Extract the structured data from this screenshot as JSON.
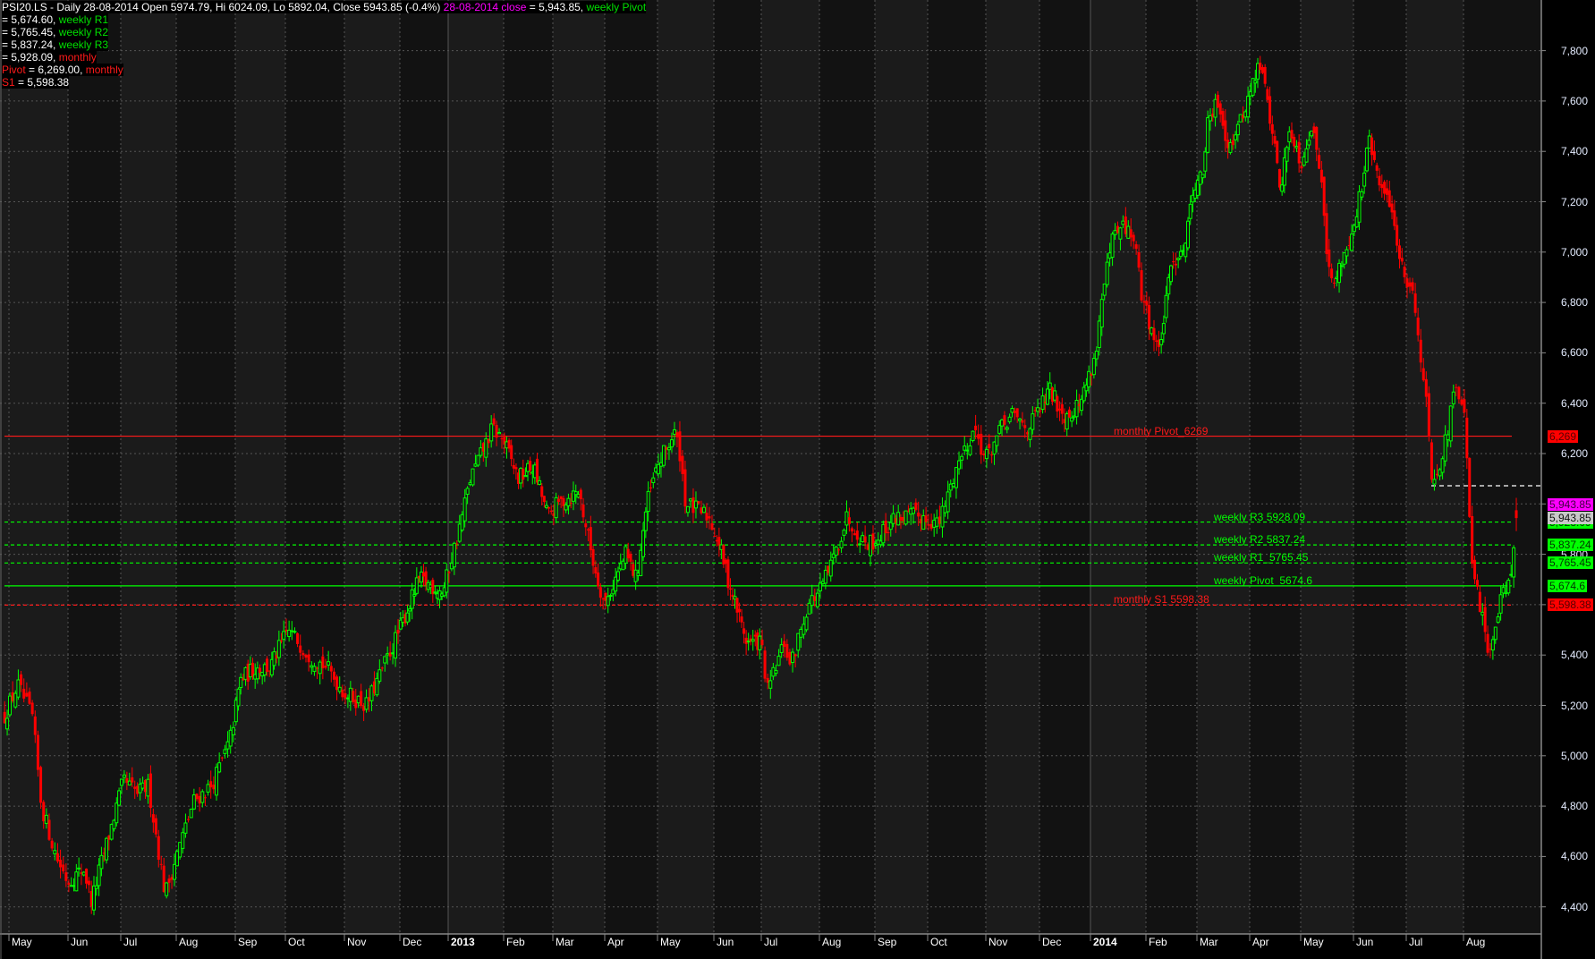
{
  "legend": {
    "line1": {
      "title": "PSI20.LS - Daily 28-08-2014 Open 5974.79, Hi 6024.09, Lo 5892.04, Close 5943.85 (-0.4%)",
      "close_label": "28-08-2014 close",
      "close_value": " = 5,943.85, ",
      "next_label": "weekly Pivot"
    },
    "rows": [
      {
        "prefix": "",
        "value": " = 5,674.60, ",
        "label": "weekly R1",
        "color": "grn"
      },
      {
        "prefix": "",
        "value": " = 5,765.45, ",
        "label": "weekly R2",
        "color": "grn"
      },
      {
        "prefix": "",
        "value": " = 5,837.24, ",
        "label": "weekly R3",
        "color": "grn"
      },
      {
        "prefix": "",
        "value": " = 5,928.09, ",
        "label": "monthly",
        "color": "red"
      },
      {
        "prefix": "Pivot",
        "value": " = 6,269.00, ",
        "label": "monthly",
        "color": "red"
      },
      {
        "prefix": "S1",
        "value": " = 5,598.38",
        "label": "",
        "color": "red"
      }
    ]
  },
  "colors": {
    "up": "#00ff00",
    "down": "#ff0000",
    "weekly": "#00ff00",
    "monthly": "#ff1a1a",
    "close": "#ff00ff",
    "grid": "#555555"
  },
  "chart_data": {
    "type": "candlestick",
    "symbol": "PSI20.LS",
    "interval": "Daily",
    "last_bar": {
      "date": "28-08-2014",
      "open": 5974.79,
      "high": 6024.09,
      "low": 5892.04,
      "close": 5943.85,
      "change_pct": -0.4
    },
    "x_ticks": [
      "May",
      "Jun",
      "Jul",
      "Aug",
      "Sep",
      "Oct",
      "Nov",
      "Dec",
      "2013",
      "Feb",
      "Mar",
      "Apr",
      "May",
      "Jun",
      "Jul",
      "Aug",
      "Sep",
      "Oct",
      "Nov",
      "Dec",
      "2014",
      "Feb",
      "Mar",
      "Apr",
      "May",
      "Jun",
      "Jul",
      "Aug"
    ],
    "y_ticks": [
      7800,
      7600,
      7400,
      7200,
      7000,
      6800,
      6600,
      6400,
      6200,
      6000,
      5800,
      5600,
      5400,
      5200,
      5000,
      4800,
      4600,
      4400
    ],
    "y_tick_labels": [
      "7,800",
      "7,600",
      "7,400",
      "7,200",
      "7,000",
      "6,800",
      "6,600",
      "6,400",
      "6,200",
      "6,000",
      "5,800",
      "5,600",
      "5,400",
      "5,200",
      "5,000",
      "4,800",
      "4,600",
      "4,400"
    ],
    "ylim": [
      4320,
      7880
    ],
    "approx_close_path_months_since_may2012": [
      [
        0,
        5200
      ],
      [
        0.15,
        5280
      ],
      [
        0.4,
        5150
      ],
      [
        0.55,
        4800
      ],
      [
        0.8,
        4600
      ],
      [
        1.0,
        4500
      ],
      [
        1.3,
        4550
      ],
      [
        1.45,
        4420
      ],
      [
        1.6,
        4550
      ],
      [
        1.8,
        4700
      ],
      [
        2.05,
        4900
      ],
      [
        2.3,
        4850
      ],
      [
        2.5,
        4880
      ],
      [
        2.8,
        4450
      ],
      [
        3.0,
        4600
      ],
      [
        3.3,
        4820
      ],
      [
        3.6,
        4880
      ],
      [
        3.9,
        5050
      ],
      [
        4.1,
        5300
      ],
      [
        4.4,
        5350
      ],
      [
        4.7,
        5350
      ],
      [
        5.05,
        5500
      ],
      [
        5.4,
        5400
      ],
      [
        5.7,
        5350
      ],
      [
        6.0,
        5250
      ],
      [
        6.4,
        5200
      ],
      [
        6.8,
        5400
      ],
      [
        7.4,
        5700
      ],
      [
        7.9,
        5650
      ],
      [
        8.2,
        5900
      ],
      [
        8.4,
        6100
      ],
      [
        8.8,
        6300
      ],
      [
        9.0,
        6250
      ],
      [
        9.3,
        6100
      ],
      [
        9.6,
        6150
      ],
      [
        9.9,
        5950
      ],
      [
        10.1,
        6000
      ],
      [
        10.5,
        6050
      ],
      [
        10.8,
        5750
      ],
      [
        11.0,
        5600
      ],
      [
        11.4,
        5800
      ],
      [
        11.6,
        5700
      ],
      [
        11.8,
        6000
      ],
      [
        12.0,
        6150
      ],
      [
        12.3,
        6280
      ],
      [
        12.4,
        6200
      ],
      [
        12.5,
        6000
      ],
      [
        12.9,
        5950
      ],
      [
        13.1,
        5850
      ],
      [
        13.3,
        5700
      ],
      [
        13.7,
        5450
      ],
      [
        14.0,
        5450
      ],
      [
        14.1,
        5250
      ],
      [
        14.4,
        5450
      ],
      [
        14.5,
        5350
      ],
      [
        14.8,
        5600
      ],
      [
        15.0,
        5650
      ],
      [
        15.2,
        5750
      ],
      [
        15.5,
        5950
      ],
      [
        15.8,
        5850
      ],
      [
        16.0,
        5850
      ],
      [
        16.4,
        5950
      ],
      [
        16.9,
        5950
      ],
      [
        17.2,
        5920
      ],
      [
        17.5,
        6150
      ],
      [
        17.8,
        6300
      ],
      [
        18.0,
        6180
      ],
      [
        18.3,
        6300
      ],
      [
        18.5,
        6350
      ],
      [
        18.8,
        6300
      ],
      [
        19.2,
        6450
      ],
      [
        19.5,
        6350
      ],
      [
        19.8,
        6400
      ],
      [
        20.1,
        6600
      ],
      [
        20.2,
        6800
      ],
      [
        20.4,
        7050
      ],
      [
        20.6,
        7100
      ],
      [
        20.8,
        7050
      ],
      [
        20.9,
        6850
      ],
      [
        21.1,
        6700
      ],
      [
        21.25,
        6600
      ],
      [
        21.4,
        6800
      ],
      [
        21.5,
        6950
      ],
      [
        21.8,
        7050
      ],
      [
        21.9,
        7250
      ],
      [
        22.1,
        7300
      ],
      [
        22.2,
        7500
      ],
      [
        22.4,
        7600
      ],
      [
        22.6,
        7420
      ],
      [
        22.8,
        7500
      ],
      [
        22.95,
        7600
      ],
      [
        23.2,
        7750
      ],
      [
        23.35,
        7600
      ],
      [
        23.5,
        7400
      ],
      [
        23.6,
        7250
      ],
      [
        23.8,
        7500
      ],
      [
        24.0,
        7350
      ],
      [
        24.2,
        7500
      ],
      [
        24.4,
        7300
      ],
      [
        24.5,
        7000
      ],
      [
        24.6,
        6850
      ],
      [
        24.75,
        6950
      ],
      [
        25.0,
        7100
      ],
      [
        25.2,
        7300
      ],
      [
        25.3,
        7450
      ],
      [
        25.5,
        7250
      ],
      [
        25.7,
        7200
      ],
      [
        25.9,
        6950
      ],
      [
        26.1,
        6850
      ],
      [
        26.2,
        6700
      ],
      [
        26.35,
        6400
      ],
      [
        26.45,
        6100
      ],
      [
        26.65,
        6200
      ],
      [
        26.85,
        6450
      ],
      [
        27.0,
        6400
      ],
      [
        27.1,
        6000
      ],
      [
        27.15,
        5750
      ],
      [
        27.3,
        5600
      ],
      [
        27.45,
        5400
      ],
      [
        27.55,
        5500
      ],
      [
        27.7,
        5650
      ],
      [
        27.85,
        5700
      ],
      [
        27.95,
        5900
      ],
      [
        27.98,
        5943.85
      ]
    ],
    "levels": [
      {
        "name": "monthly-pivot",
        "value": 6269,
        "label": "monthly Pivot_6269",
        "box": "6,269",
        "style": "solid",
        "color": "monthly"
      },
      {
        "name": "weekly-r3",
        "value": 5928.09,
        "label": "weekly R3 5928.09",
        "box": "5,928.09",
        "style": "dashed",
        "color": "weekly"
      },
      {
        "name": "weekly-r2",
        "value": 5837.24,
        "label": "weekly R2 5837.24",
        "box": "5,837.24",
        "style": "dashed",
        "color": "weekly"
      },
      {
        "name": "weekly-r1",
        "value": 5765.45,
        "label": "weekly R1_5765.45",
        "box": "5,765.45",
        "style": "dashed",
        "color": "weekly"
      },
      {
        "name": "weekly-pivot",
        "value": 5674.6,
        "label": "weekly Pivot_5674.6",
        "box": "5,674.6",
        "style": "solid",
        "color": "weekly"
      },
      {
        "name": "monthly-s1",
        "value": 5598.38,
        "label": "monthly S1 5598.38",
        "box": "5,598.38",
        "style": "dashed",
        "color": "monthly"
      }
    ],
    "close_box": "5,943.85",
    "last_price_box": "5,943.85",
    "prev_close_marker": 6070
  }
}
